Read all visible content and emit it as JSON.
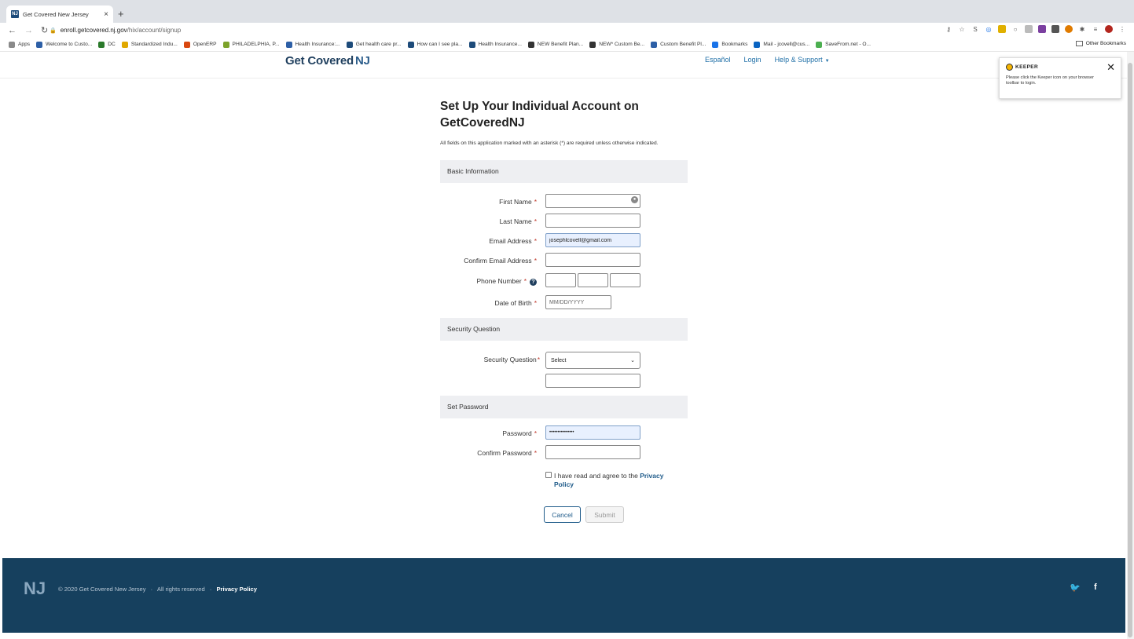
{
  "browser": {
    "tab_title": "Get Covered New Jersey",
    "tab_favicon": "NJ",
    "tab_close": "×",
    "new_tab": "+",
    "url_domain": "enroll.getcovered.nj.gov",
    "url_path": "/hix/account/signup",
    "bookmarks": [
      {
        "label": "Apps",
        "color": "#8a8a8a"
      },
      {
        "label": "Welcome to Custo...",
        "color": "#2d5fa6"
      },
      {
        "label": "DC",
        "color": "#2b7a2b"
      },
      {
        "label": "Standardized Indu...",
        "color": "#e0a800"
      },
      {
        "label": "OpenERP",
        "color": "#d9480f"
      },
      {
        "label": "PHILADELPHIA, P...",
        "color": "#7da32b"
      },
      {
        "label": "Health Insurance:...",
        "color": "#2d5fa6"
      },
      {
        "label": "Get health care pr...",
        "color": "#1d4b7a"
      },
      {
        "label": "How can I see pla...",
        "color": "#1d4b7a"
      },
      {
        "label": "Health Insurance...",
        "color": "#1d4b7a"
      },
      {
        "label": "NEW Benefit Plan...",
        "color": "#333333"
      },
      {
        "label": "NEW* Custom Be...",
        "color": "#333333"
      },
      {
        "label": "Custom Benefit Pl...",
        "color": "#2d5fa6"
      },
      {
        "label": "Bookmarks",
        "color": "#1a73e8"
      },
      {
        "label": "Mail - jcovell@cus...",
        "color": "#0a64c2"
      },
      {
        "label": "SaveFrom.net - O...",
        "color": "#4caf50"
      }
    ],
    "other_bookmarks": "Other Bookmarks"
  },
  "header": {
    "brand": "Get Covered",
    "brand_mark": "NJ",
    "nav": {
      "espanol": "Español",
      "login": "Login",
      "help": "Help & Support"
    }
  },
  "form": {
    "title": "Set Up Your Individual Account on GetCoveredNJ",
    "required_note": "All fields on this application marked with an asterisk (*) are required unless otherwise indicated.",
    "required_mark": "*",
    "sections": {
      "basic": "Basic Information",
      "security": "Security Question",
      "password": "Set Password"
    },
    "labels": {
      "first_name": "First Name",
      "last_name": "Last Name",
      "email": "Email Address",
      "confirm_email": "Confirm Email Address",
      "phone": "Phone Number",
      "dob": "Date of Birth",
      "security_question": "Security Question",
      "password": "Password",
      "confirm_password": "Confirm Password"
    },
    "values": {
      "first_name": "",
      "last_name": "",
      "email": "josephlcovell@gmail.com",
      "confirm_email": "",
      "phone_area": "",
      "phone_prefix": "",
      "phone_line": "",
      "security_answer": "",
      "password_masked": "•••••••••••••••",
      "confirm_password": ""
    },
    "placeholders": {
      "dob": "MM/DD/YYYY"
    },
    "security_select": "Select",
    "agree_text": "I have read and agree to the",
    "privacy_link": "Privacy Policy",
    "cancel": "Cancel",
    "submit": "Submit"
  },
  "keeper": {
    "name": "KEEPER",
    "message": "Please click the Keeper icon on your browser toolbar to login.",
    "close": "✕"
  },
  "footer": {
    "copyright": "© 2020 Get Covered New Jersey",
    "rights": "All rights reserved",
    "privacy": "Privacy Policy",
    "separator": "·",
    "twitter": "🐦",
    "facebook": "f"
  }
}
